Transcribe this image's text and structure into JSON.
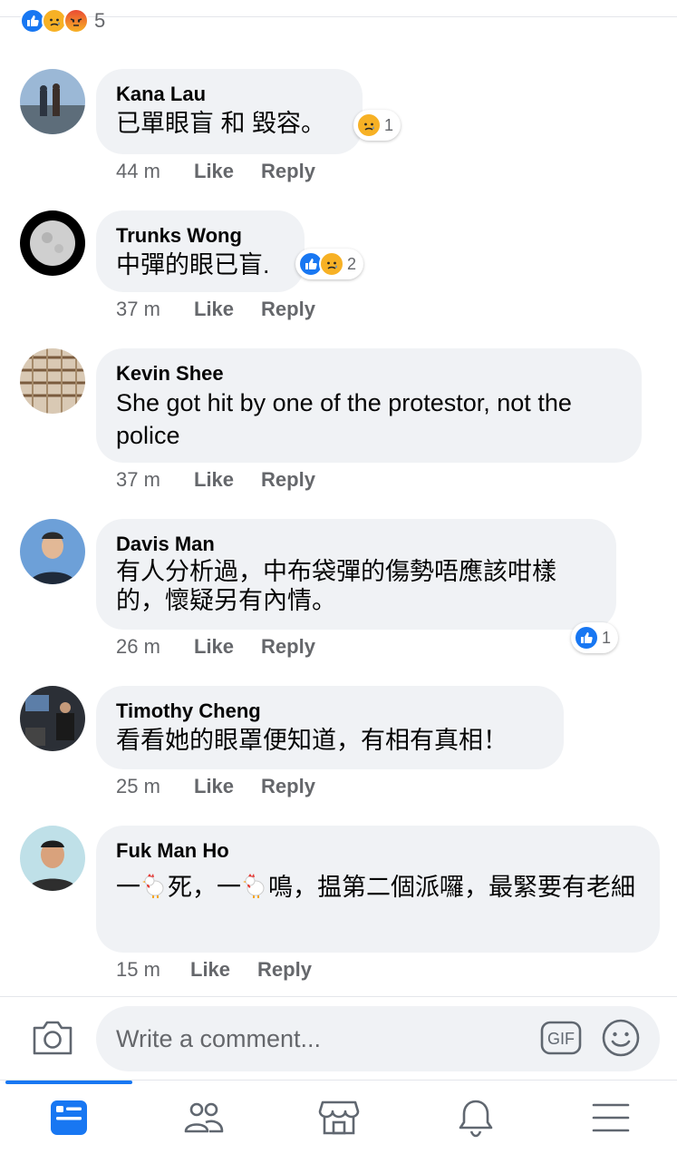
{
  "reactions_summary": {
    "icons": [
      "like-icon",
      "sad-icon",
      "angry-icon"
    ],
    "count": "5"
  },
  "comments": [
    {
      "author": "Kana Lau",
      "text": "已單眼盲 和 毀容。",
      "time": "44 m",
      "like": "Like",
      "reply": "Reply",
      "reaction_icons": [
        "sad-icon"
      ],
      "reaction_count": "1"
    },
    {
      "author": "Trunks Wong",
      "text": "中彈的眼已盲.",
      "time": "37 m",
      "like": "Like",
      "reply": "Reply",
      "reaction_icons": [
        "like-icon",
        "sad-icon"
      ],
      "reaction_count": "2"
    },
    {
      "author": "Kevin Shee",
      "text": "She got hit by one of the protestor, not the police",
      "time": "37 m",
      "like": "Like",
      "reply": "Reply"
    },
    {
      "author": "Davis Man",
      "text": "有人分析過，中布袋彈的傷勢唔應該咁樣的，懷疑另有內情。",
      "time": "26 m",
      "like": "Like",
      "reply": "Reply",
      "reaction_icons": [
        "like-icon"
      ],
      "reaction_count": "1"
    },
    {
      "author": "Timothy Cheng",
      "text": "看看她的眼罩便知道，有相有真相！",
      "time": "25 m",
      "like": "Like",
      "reply": "Reply"
    },
    {
      "author": "Fuk Man Ho",
      "text_parts": [
        "一",
        "死，一",
        "鳴，揾第二個派囉，最緊要有老細"
      ],
      "time": "15 m",
      "like": "Like",
      "reply": "Reply"
    }
  ],
  "composer": {
    "placeholder": "Write a comment...",
    "gif_label": "GIF"
  },
  "tabbar": {
    "items": [
      "news-feed-icon",
      "friends-icon",
      "marketplace-icon",
      "notifications-icon",
      "menu-icon"
    ],
    "active": "news-feed-icon"
  },
  "colors": {
    "accent": "#1877f2",
    "bubble": "#f0f2f5",
    "secondary_text": "#65676b"
  }
}
